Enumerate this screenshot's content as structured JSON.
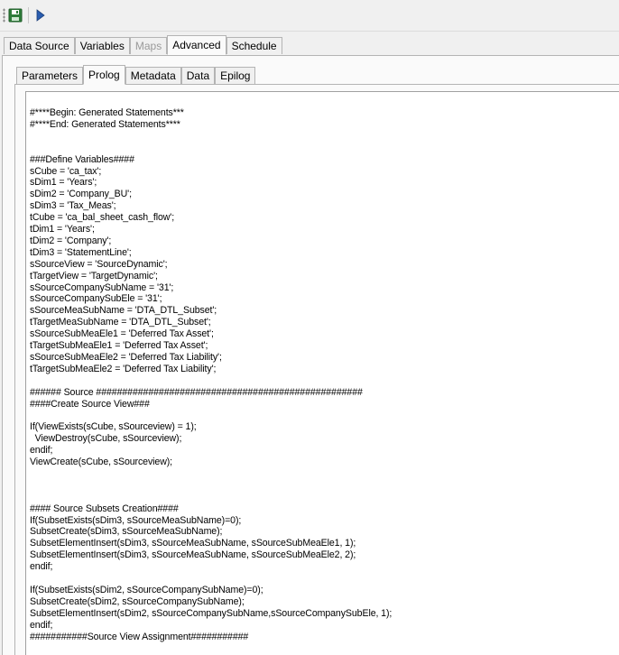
{
  "toolbar": {
    "save_icon": "save-icon",
    "run_icon": "run-icon"
  },
  "outer_tabs": [
    {
      "label": "Data Source",
      "state": "normal"
    },
    {
      "label": "Variables",
      "state": "normal"
    },
    {
      "label": "Maps",
      "state": "disabled"
    },
    {
      "label": "Advanced",
      "state": "active"
    },
    {
      "label": "Schedule",
      "state": "normal"
    }
  ],
  "inner_tabs": [
    {
      "label": "Parameters",
      "state": "normal"
    },
    {
      "label": "Prolog",
      "state": "active"
    },
    {
      "label": "Metadata",
      "state": "normal"
    },
    {
      "label": "Data",
      "state": "normal"
    },
    {
      "label": "Epilog",
      "state": "normal"
    }
  ],
  "editor": {
    "lines": [
      "#****Begin: Generated Statements***",
      "#****End: Generated Statements****",
      "",
      "",
      "###Define Variables####",
      "sCube = 'ca_tax';",
      "sDim1 = 'Years';",
      "sDim2 = 'Company_BU';",
      "sDim3 = 'Tax_Meas';",
      "tCube = 'ca_bal_sheet_cash_flow';",
      "tDim1 = 'Years';",
      "tDim2 = 'Company';",
      "tDim3 = 'StatementLine';",
      "sSourceView = 'SourceDynamic';",
      "tTargetView = 'TargetDynamic';",
      "sSourceCompanySubName = '31';",
      "sSourceCompanySubEle = '31';",
      "sSourceMeaSubName = 'DTA_DTL_Subset';",
      "tTargetMeaSubName = 'DTA_DTL_Subset';",
      "sSourceSubMeaEle1 = 'Deferred Tax Asset';",
      "tTargetSubMeaEle1 = 'Deferred Tax Asset';",
      "sSourceSubMeaEle2 = 'Deferred Tax Liability';",
      "tTargetSubMeaEle2 = 'Deferred Tax Liability';",
      "",
      "###### Source ###################################################",
      "####Create Source View###",
      "",
      "If(ViewExists(sCube, sSourceview) = 1);",
      "  ViewDestroy(sCube, sSourceview);",
      "endif;",
      "ViewCreate(sCube, sSourceview);",
      "",
      "",
      "",
      "#### Source Subsets Creation####",
      "If(SubsetExists(sDim3, sSourceMeaSubName)=0);",
      "SubsetCreate(sDim3, sSourceMeaSubName);",
      "SubsetElementInsert(sDim3, sSourceMeaSubName, sSourceSubMeaEle1, 1);",
      "SubsetElementInsert(sDim3, sSourceMeaSubName, sSourceSubMeaEle2, 2);",
      "endif;",
      "",
      "If(SubsetExists(sDim2, sSourceCompanySubName)=0);",
      "SubsetCreate(sDim2, sSourceCompanySubName);",
      "SubsetElementInsert(sDim2, sSourceCompanySubName,sSourceCompanySubEle, 1);",
      "endif;",
      "###########Source View Assignment###########"
    ]
  }
}
